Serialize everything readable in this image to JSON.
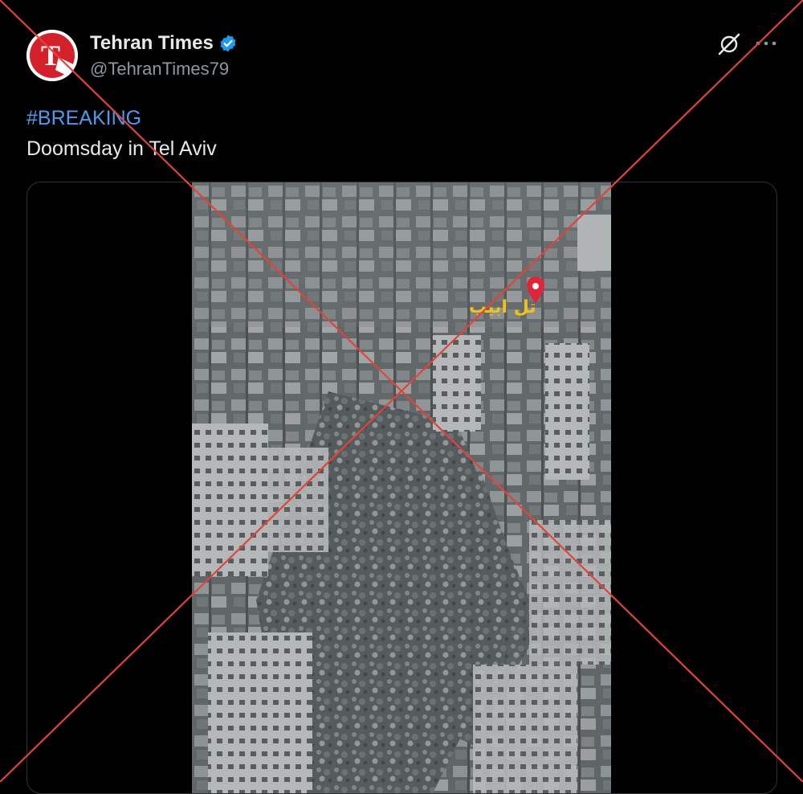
{
  "tweet": {
    "author": {
      "display_name": "Tehran Times",
      "handle": "@TehranTimes79",
      "verified": true,
      "avatar_letter": "T",
      "avatar_color": "#d4202a"
    },
    "text": {
      "hashtag": "#BREAKING",
      "body": "Doomsday in Tel Aviv"
    },
    "media": {
      "type": "video",
      "overlay_label": "تل ابيب"
    },
    "actions": {
      "grok_icon": "grok-icon",
      "more_icon": "more-icon"
    }
  },
  "overlay": {
    "type": "red-cross-fact-check",
    "color": "#e0443a"
  },
  "colors": {
    "background": "#000000",
    "text": "#e7e9ea",
    "secondary_text": "#8b98a5",
    "link": "#4a9cf0",
    "verified": "#1d9bf0"
  }
}
